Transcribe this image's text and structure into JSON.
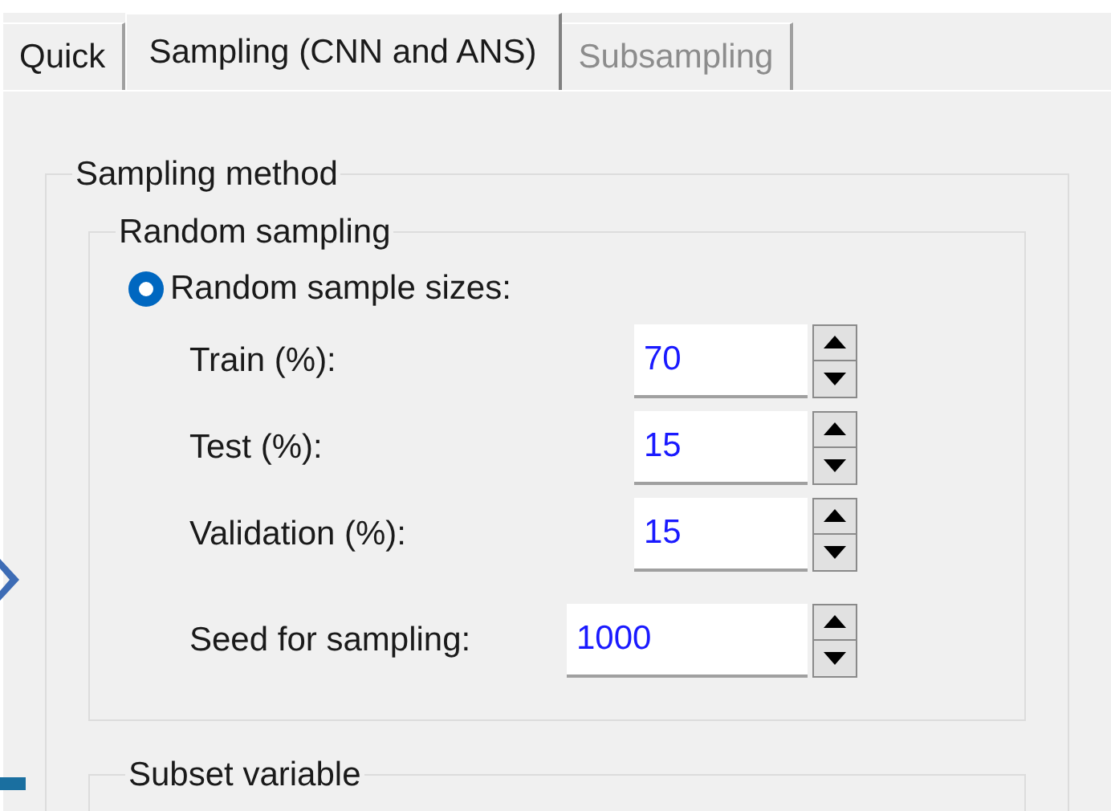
{
  "tabs": [
    {
      "label": "Quick",
      "selected": false,
      "disabled": false
    },
    {
      "label": "Sampling (CNN and ANS)",
      "selected": true,
      "disabled": false
    },
    {
      "label": "Subsampling",
      "selected": false,
      "disabled": true
    }
  ],
  "sampling_method": {
    "title": "Sampling method",
    "random_sampling": {
      "title": "Random sampling",
      "option": {
        "label": "Random sample sizes:",
        "selected": true
      },
      "fields": [
        {
          "label": "Train (%):",
          "value": "70"
        },
        {
          "label": "Test (%):",
          "value": "15"
        },
        {
          "label": "Validation (%):",
          "value": "15"
        }
      ],
      "seed": {
        "label": "Seed for sampling:",
        "value": "1000"
      }
    },
    "subset_variable": {
      "title": "Subset variable"
    }
  }
}
